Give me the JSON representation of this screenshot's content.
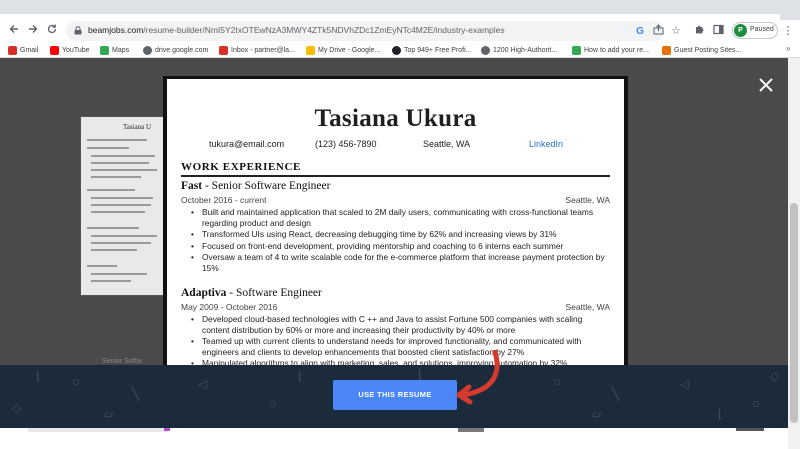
{
  "browser": {
    "url_host": "beamjobs.com",
    "url_path": "/resume-builder/NmI5Y2IxOTEwNzA3MWY4ZTk5NDVhZDc1ZmEyNTc4M2E/industry-examples",
    "profile_initial": "P",
    "profile_status": "Paused",
    "bookmarks": [
      {
        "label": "Gmail",
        "color": "#d93025"
      },
      {
        "label": "YouTube",
        "color": "#ff0000"
      },
      {
        "label": "Maps",
        "color": "#34a853"
      },
      {
        "label": "drive.google.com",
        "color": "#5f6368"
      },
      {
        "label": "Inbox - partner@la...",
        "color": "#d93025"
      },
      {
        "label": "My Drive - Google...",
        "color": "#fbbc04"
      },
      {
        "label": "Top 949+ Free Profi...",
        "color": "#202124"
      },
      {
        "label": "1200 High-Authorit...",
        "color": "#5f6368"
      },
      {
        "label": "How to add your re...",
        "color": "#34a853"
      },
      {
        "label": "Guest Posting Sites...",
        "color": "#e8710a"
      }
    ],
    "bookmarks_more": "»"
  },
  "resume": {
    "name": "Tasiana Ukura",
    "email": "tukura@email.com",
    "phone": "(123) 456-7890",
    "location": "Seattle, WA",
    "linkedin": "LinkedIn",
    "section_title": "WORK EXPERIENCE",
    "jobs": [
      {
        "company": "Fast",
        "role": " - Senior Software Engineer",
        "dates": "October 2016 - current",
        "location": "Seattle, WA",
        "bullets": [
          "Built and maintained application that scaled to 2M daily users, communicating with cross-functional teams regarding product and design",
          "Transformed UIs using React, decreasing debugging time by 62% and increasing views by 31%",
          "Focused on front-end development, providing mentorship and coaching to 6 interns each summer",
          "Oversaw a team of 4 to write scalable code for the e-commerce platform that increase payment protection by 15%"
        ]
      },
      {
        "company": "Adaptiva",
        "role": " - Software Engineer",
        "dates": "May 2009 - October 2016",
        "location": "Seattle, WA",
        "bullets": [
          "Developed cloud-based technologies with C ++ and Java to assist Fortune 500 companies with scaling content distribution by 60% or more and increasing their productivity by 40% or more",
          "Teamed up with current clients to understand needs for improved functionality, and communicated with engineers and clients to develop enhancements that boosted client satisfaction by 27%",
          "Manipulated algorithms to align with marketing, sales, and solutions, improving automation by 32%"
        ]
      }
    ]
  },
  "thumbnail": {
    "name": "Tasiana U",
    "caption": "Senior Softw"
  },
  "cta": {
    "label": "USE THIS RESUME"
  },
  "colors": {
    "overlay": "#4a4a4a",
    "cta_bar": "#1b2b3c",
    "cta_button": "#4a86f6",
    "arrow": "#d63a2f",
    "link": "#2a73c9"
  }
}
